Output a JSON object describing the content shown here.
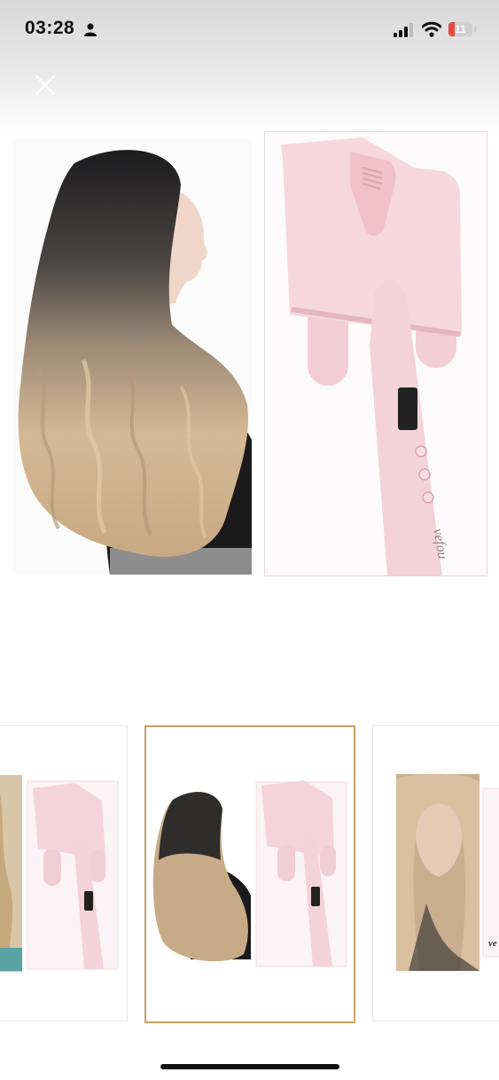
{
  "status_bar": {
    "time": "03:28",
    "battery_level": "11",
    "icons": [
      "person-icon",
      "signal-icon",
      "wifi-icon",
      "battery-icon"
    ]
  },
  "viewer": {
    "close_icon": "close-icon",
    "main_image": {
      "left_photo": "woman-wavy-ombre-hair",
      "right_photo": "pink-triple-barrel-waver"
    },
    "product_brand_mark": "vefou",
    "thumbnails": [
      {
        "content": "beach-waves-model-and-waver",
        "selected": false
      },
      {
        "content": "ombre-hair-model-and-waver",
        "selected": true
      },
      {
        "content": "blonde-waves-model-and-waver",
        "selected": false
      }
    ],
    "thumbnail_brand_mark": "ve"
  },
  "colors": {
    "product_pink": "#f3d3da",
    "selected_border": "#c7a16a",
    "battery_low": "#e5493f"
  }
}
